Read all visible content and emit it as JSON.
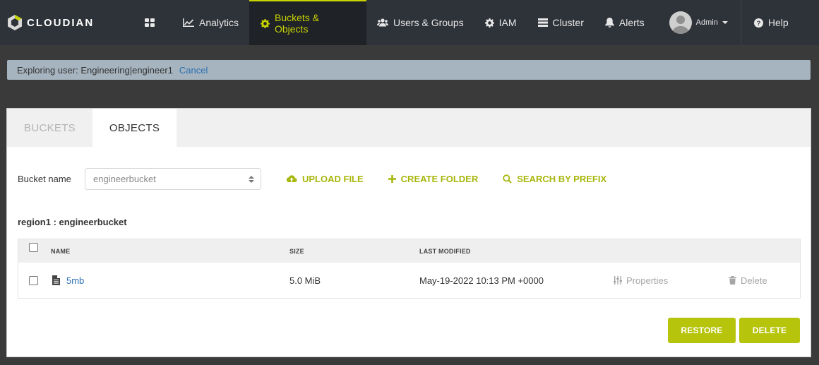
{
  "app": {
    "brand": "CLOUDIAN"
  },
  "nav": {
    "analytics": "Analytics",
    "buckets_objects": "Buckets & Objects",
    "users_groups": "Users & Groups",
    "iam": "IAM",
    "cluster": "Cluster",
    "alerts": "Alerts",
    "user": "Admin",
    "help": "Help"
  },
  "explore": {
    "text": "Exploring user: Engineering|engineer1",
    "cancel": "Cancel"
  },
  "tabs": [
    {
      "label": "BUCKETS",
      "active": false
    },
    {
      "label": "OBJECTS",
      "active": true
    }
  ],
  "toolbar": {
    "bucket_label": "Bucket name",
    "bucket_value": "engineerbucket",
    "upload": "UPLOAD FILE",
    "create_folder": "CREATE FOLDER",
    "search_prefix": "SEARCH BY PREFIX"
  },
  "region_label": "region1 : engineerbucket",
  "table": {
    "headers": {
      "name": "NAME",
      "size": "SIZE",
      "modified": "LAST MODIFIED"
    },
    "rows": [
      {
        "name": "5mb",
        "size": "5.0 MiB",
        "modified": "May-19-2022 10:13 PM +0000",
        "properties": "Properties",
        "delete": "Delete"
      }
    ]
  },
  "buttons": {
    "restore": "RESTORE",
    "delete": "DELETE"
  },
  "colors": {
    "accent": "#b7c40c",
    "navbar": "#2e3239",
    "link": "#2a6fb0"
  }
}
